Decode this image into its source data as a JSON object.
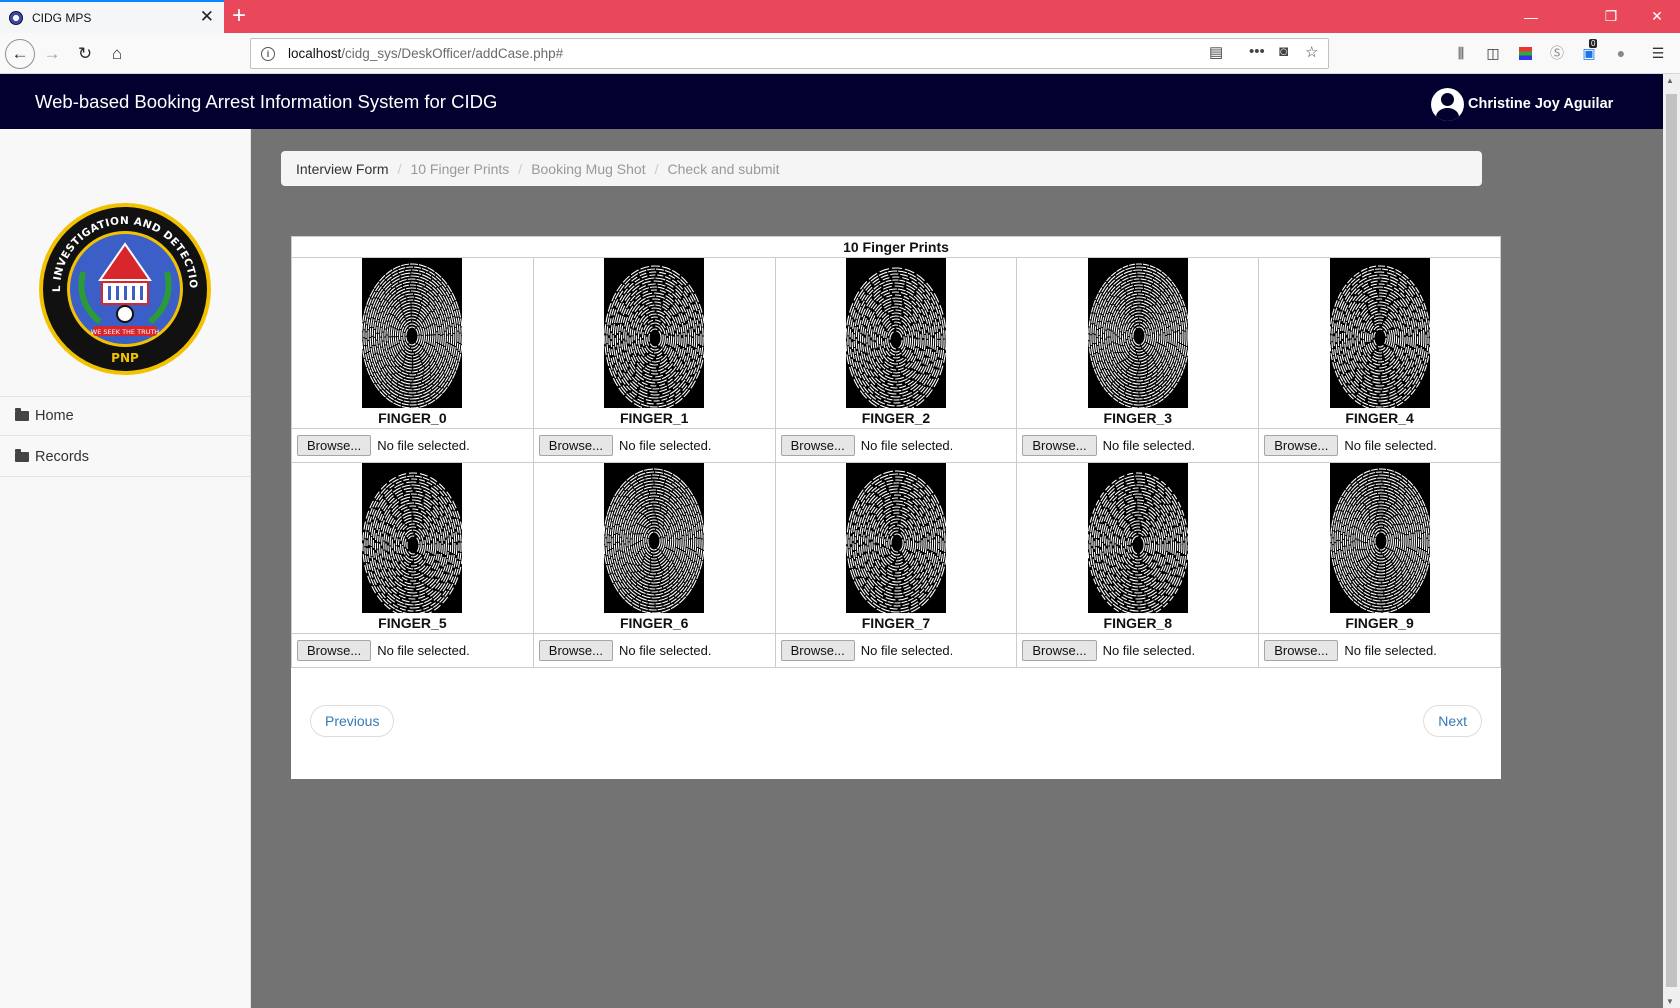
{
  "browser": {
    "tab_title": "CIDG MPS",
    "url_host": "localhost",
    "url_path": "/cidg_sys/DeskOfficer/addCase.php#",
    "badge_count": "0"
  },
  "header": {
    "title": "Web-based Booking Arrest Information System for CIDG",
    "user_name": "Christine Joy Aguilar"
  },
  "sidebar": {
    "logo": {
      "ring_text": "CRIMINAL INVESTIGATION AND DETECTION GROUP",
      "motto": "WE SEEK THE TRUTH",
      "bottom": "PNP"
    },
    "items": [
      {
        "label": "Home"
      },
      {
        "label": "Records"
      }
    ]
  },
  "breadcrumb": [
    {
      "label": "Interview Form",
      "active": true
    },
    {
      "label": "10 Finger Prints",
      "active": false
    },
    {
      "label": "Booking Mug Shot",
      "active": false
    },
    {
      "label": "Check and submit",
      "active": false
    }
  ],
  "fingerprints": {
    "title": "10 Finger Prints",
    "browse_label": "Browse...",
    "no_file_label": "No file selected.",
    "fingers": [
      "FINGER_0",
      "FINGER_1",
      "FINGER_2",
      "FINGER_3",
      "FINGER_4",
      "FINGER_5",
      "FINGER_6",
      "FINGER_7",
      "FINGER_8",
      "FINGER_9"
    ]
  },
  "pager": {
    "previous": "Previous",
    "next": "Next"
  },
  "colors": {
    "tab_bar": "#e8485a",
    "header_bg": "#02002e",
    "main_bg": "#737373",
    "link": "#337ab7"
  }
}
